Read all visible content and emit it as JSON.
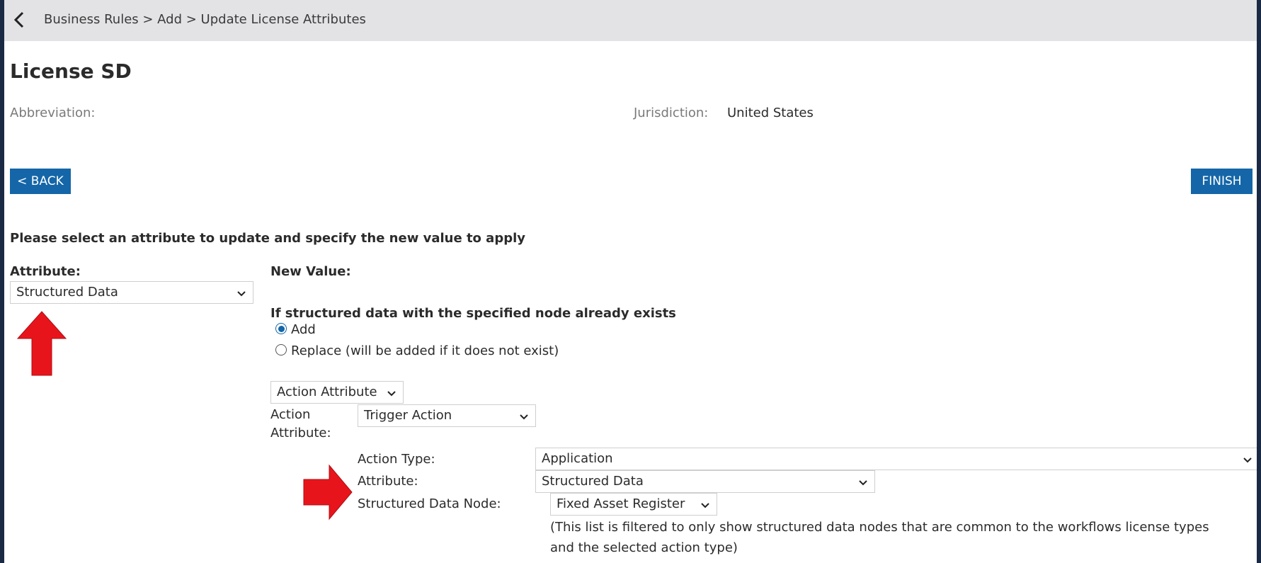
{
  "header": {
    "breadcrumb": "Business Rules > Add > Update License Attributes"
  },
  "page": {
    "title": "License SD",
    "abbreviation_label": "Abbreviation:",
    "jurisdiction_label": "Jurisdiction:",
    "jurisdiction_value": "United States"
  },
  "buttons": {
    "back": "< BACK",
    "finish": "FINISH"
  },
  "form": {
    "instruction": "Please select an attribute to update and specify the new value to apply",
    "attribute_label": "Attribute:",
    "attribute_value": "Structured Data",
    "new_value_label": "New Value:",
    "exists_heading": "If structured data with the specified node already exists",
    "radio_add": "Add",
    "radio_replace": "Replace (will be added if it does not exist)",
    "radio_selected": "Add",
    "action_attribute_select": "Action Attribute",
    "action_attribute_label_line1": "Action",
    "action_attribute_label_line2": "Attribute:",
    "trigger_action_value": "Trigger Action",
    "action_type_label": "Action Type:",
    "action_type_value": "Application",
    "sub_attribute_label": "Attribute:",
    "sub_attribute_value": "Structured Data",
    "structured_node_label": "Structured Data Node:",
    "structured_node_value": "Fixed Asset Register",
    "filter_note": "(This list is filtered to only show structured data nodes that are common to the workflows license types and the selected action type)"
  },
  "icons": {
    "back": "chevron-left-icon",
    "dropdown": "chevron-down-icon",
    "annotation": "red-arrow-icon"
  },
  "colors": {
    "accent": "#1466a8",
    "annotation": "#e8141c",
    "topbar": "#e3e3e6",
    "outer_frame": "#1b2a44"
  }
}
